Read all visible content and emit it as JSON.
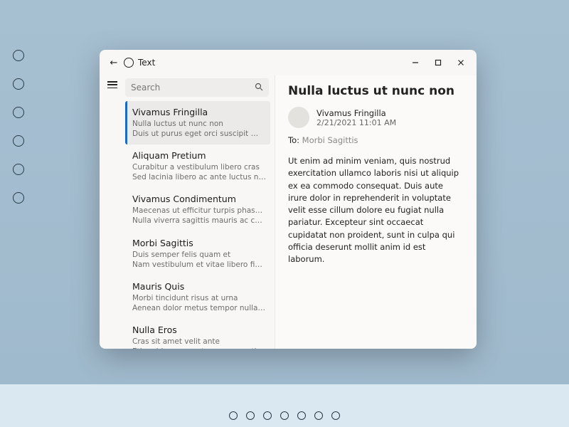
{
  "window": {
    "title": "Text"
  },
  "search": {
    "placeholder": "Search"
  },
  "list": [
    {
      "title": "Vivamus Fringilla",
      "line2": "Nulla luctus ut nunc non",
      "line3": "Duis ut purus eget orci suscipit malesuada",
      "selected": true
    },
    {
      "title": "Aliquam Pretium",
      "line2": "Curabitur a vestibulum libero cras",
      "line3": "Sed lacinia libero ac ante luctus nec interdum"
    },
    {
      "title": "Vivamus Condimentum",
      "line2": "Maecenas ut efficitur turpis phasellus",
      "line3": "Nulla viverra sagittis mauris ac convallis"
    },
    {
      "title": "Morbi Sagittis",
      "line2": "Duis semper felis quam et",
      "line3": "Nam vestibulum et vitae libero finibus et"
    },
    {
      "title": "Mauris Quis",
      "line2": "Morbi tincidunt risus at urna",
      "line3": "Aenean dolor metus tempor nulla ac dapibus"
    },
    {
      "title": "Nulla Eros",
      "line2": "Cras sit amet velit ante",
      "line3": "Etiam id consequat augue nam tincidunt"
    }
  ],
  "detail": {
    "subject": "Nulla luctus ut nunc non",
    "sender": "Vivamus Fringilla",
    "date": "2/21/2021 11:01 AM",
    "to_label": "To:",
    "to_value": "Morbi Sagittis",
    "body": "Ut enim ad minim veniam, quis nostrud exercitation ullamco laboris nisi ut aliquip ex ea commodo consequat. Duis aute irure dolor in reprehenderit in voluptate velit esse cillum dolore eu fugiat nulla pariatur. Excepteur sint occaecat cupidatat non proident, sunt in culpa qui officia deserunt mollit anim id est laborum."
  },
  "desktop_icon_count": 6,
  "pager_count": 7
}
